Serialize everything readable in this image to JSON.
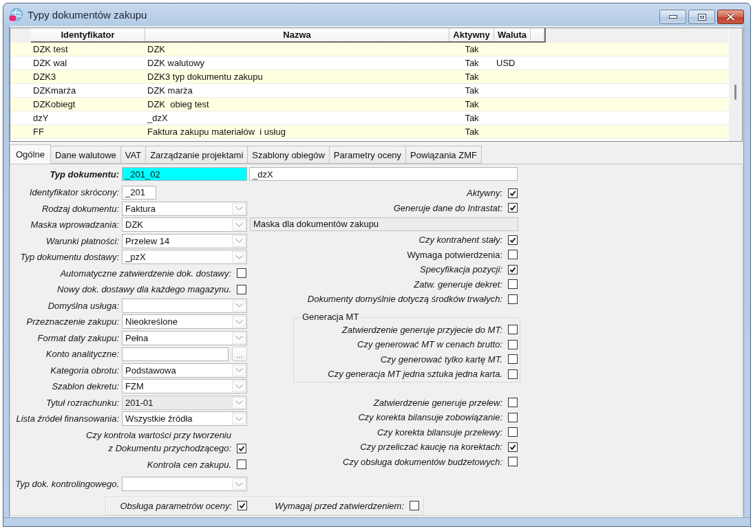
{
  "window": {
    "title": "Typy dokumentów zakupu"
  },
  "table": {
    "columns": [
      "Identyfikator",
      "Nazwa",
      "Aktywny",
      "Waluta"
    ],
    "rows": [
      {
        "identyfikator": "DZK test",
        "nazwa": "DZK",
        "aktywny": "Tak"
      },
      {
        "identyfikator": "DZK wal",
        "nazwa": "DZK walutowy",
        "aktywny": "Tak",
        "waluta": "USD"
      },
      {
        "identyfikator": "DZK3",
        "nazwa": "DZK3 typ dokumentu zakupu",
        "aktywny": "Tak"
      },
      {
        "identyfikator": "DZKmarża",
        "nazwa": "DZK marża",
        "aktywny": "Tak"
      },
      {
        "identyfikator": "DZKobiegt",
        "nazwa": "DZK  obieg test",
        "aktywny": "Tak"
      },
      {
        "identyfikator": "dzY",
        "nazwa": "_dzX",
        "aktywny": "Tak"
      },
      {
        "identyfikator": "FF",
        "nazwa": "Faktura zakupu materiałów  i usług",
        "aktywny": "Tak"
      }
    ]
  },
  "tabs": [
    {
      "label": "Ogólne",
      "selected": true
    },
    {
      "label": "Dane walutowe",
      "selected": false
    },
    {
      "label": "VAT",
      "selected": false
    },
    {
      "label": "Zarządzanie projektami",
      "selected": false
    },
    {
      "label": "Szablony obiegów",
      "selected": false
    },
    {
      "label": "Parametry oceny",
      "selected": false
    },
    {
      "label": "Powiązania ZMF",
      "selected": false
    }
  ],
  "form": {
    "document_type": {
      "label": "Typ dokumentu:",
      "label_bold": true,
      "code": "_201_02",
      "code_focused": true,
      "name": "_dzX"
    },
    "left": [
      {
        "kind": "short-text",
        "label": "Identyfikator skrócony:",
        "value": "_201"
      },
      {
        "kind": "combo",
        "label": "Rodzaj dokumentu:",
        "value": "Faktura",
        "disabled": false
      },
      {
        "kind": "combo",
        "label": "Maska wprowadzania:",
        "value": "DZK",
        "disabled": false
      },
      {
        "kind": "combo",
        "label": "Warunki płatności:",
        "value": "Przelew 14",
        "disabled": false
      },
      {
        "kind": "combo",
        "label": "Typ dokumentu dostawy:",
        "value": "_pzX",
        "disabled": false
      },
      {
        "kind": "checkbox",
        "label": "Automatyczne zatwierdzenie dok. dostawy:",
        "checked": false
      },
      {
        "kind": "checkbox",
        "label": "Nowy dok. dostawy dla każdego magazynu.",
        "checked": false
      },
      {
        "kind": "combo",
        "label": "Domyślna usługa:",
        "disabled": false
      },
      {
        "kind": "combo",
        "label": "Przeznaczenie zakupu:",
        "value": "Nieokreślone",
        "disabled": false
      },
      {
        "kind": "combo",
        "label": "Format daty zakupu:",
        "value": "Pełna",
        "disabled": false
      },
      {
        "kind": "browse",
        "label": "Konto analityczne:",
        "button": "..."
      },
      {
        "kind": "combo",
        "label": "Kategoria obrotu:",
        "value": "Podstawowa",
        "disabled": false
      },
      {
        "kind": "combo",
        "label": "Szablon dekretu:",
        "value": "FZM",
        "disabled": false
      },
      {
        "kind": "combo",
        "label": "Tytuł rozrachunku:",
        "value": "201-01",
        "disabled": true
      },
      {
        "kind": "combo",
        "label": "Lista źródeł finansowania:",
        "value": "Wszystkie źródła",
        "disabled": false
      },
      {
        "kind": "checkbox",
        "label": "Czy kontrola wartości przy tworzeniu\nz Dokumentu przychodzącego:",
        "checked": true
      },
      {
        "kind": "checkbox",
        "label": "Kontrola cen zakupu.",
        "checked": false
      }
    ],
    "controlling_document_type": {
      "label": "Typ dok. kontrolingowego.",
      "disabled": false
    },
    "right": [
      {
        "kind": "checkbox",
        "label": "Aktywny:",
        "checked": true,
        "italic": true
      },
      {
        "kind": "checkbox",
        "label": "Generuje dane do Intrastat:",
        "checked": true,
        "italic": true
      },
      {
        "kind": "description",
        "value": "Maska dla dokumentów zakupu"
      },
      {
        "kind": "checkbox",
        "label": "Czy kontrahent stały:",
        "checked": true,
        "italic": true
      },
      {
        "kind": "checkbox",
        "label": "Wymaga potwierdzenia:",
        "checked": false,
        "italic": false
      },
      {
        "kind": "checkbox",
        "label": "Specyfikacja pozycji:",
        "checked": true,
        "italic": true
      },
      {
        "kind": "checkbox",
        "label": "Zatw. generuje dekret:",
        "checked": false,
        "italic": true
      },
      {
        "kind": "checkbox",
        "label": "Dokumenty domyślnie dotyczą środków trwałych:",
        "checked": false,
        "italic": true
      },
      {
        "kind": "group",
        "title": "Generacja MT",
        "items": [
          {
            "label": "Zatwierdzenie generuje przyjecie do MT:",
            "checked": false,
            "italic": true
          },
          {
            "label": "Czy generować MT w cenach brutto:",
            "checked": false,
            "italic": true
          },
          {
            "label": "Czy generować tylko kartę MT.",
            "checked": false,
            "italic": true
          },
          {
            "label": "Czy generacja MT jedna sztuka jedna karta.",
            "checked": false,
            "italic": true
          }
        ]
      },
      {
        "kind": "checkbox",
        "label": "Zatwierdzenie generuje przelew:",
        "checked": false,
        "italic": true
      },
      {
        "kind": "checkbox",
        "label": "Czy korekta bilansuje zobowiązanie:",
        "checked": false,
        "italic": true
      },
      {
        "kind": "checkbox",
        "label": "Czy korekta bilansuje przelewy:",
        "checked": false,
        "italic": true
      },
      {
        "kind": "checkbox",
        "label": "Czy przeliczać kaucję na korektach:",
        "checked": true,
        "italic": true
      },
      {
        "kind": "checkbox",
        "label": "Czy obsługa dokumentów budżetowych:",
        "checked": false,
        "italic": true
      }
    ],
    "evaluation": [
      {
        "label": "Obsługa parametrów oceny:",
        "checked": true
      },
      {
        "label": "Wymagaj przed zatwierdzeniem:",
        "checked": false
      }
    ]
  }
}
